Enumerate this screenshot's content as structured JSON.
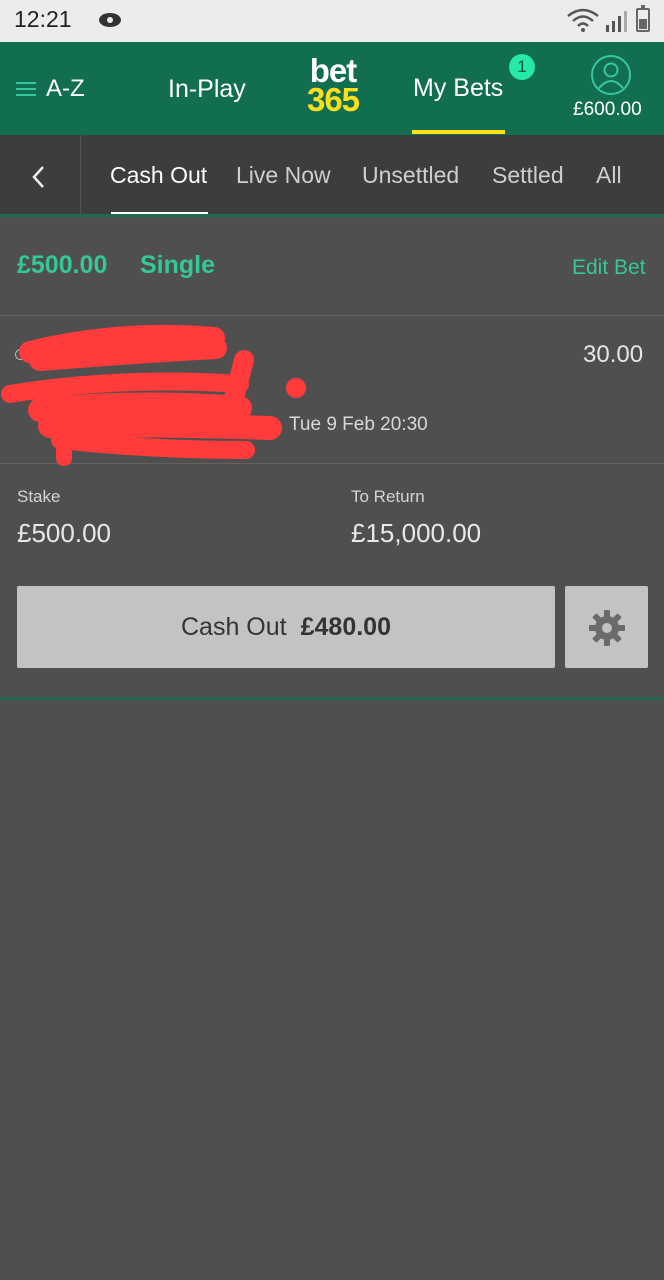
{
  "status_bar": {
    "time": "12:21"
  },
  "header": {
    "az_label": "A-Z",
    "inplay_label": "In-Play",
    "logo_line1": "bet",
    "logo_line2": "365",
    "mybets_label": "My Bets",
    "mybets_badge": "1",
    "balance": "£600.00"
  },
  "tabs": [
    {
      "label": "Cash Out",
      "active": true
    },
    {
      "label": "Live Now",
      "active": false
    },
    {
      "label": "Unsettled",
      "active": false
    },
    {
      "label": "Settled",
      "active": false
    },
    {
      "label": "All",
      "active": false
    }
  ],
  "bet": {
    "stake_title": "£500.00",
    "type": "Single",
    "edit_label": "Edit Bet",
    "odds": "30.00",
    "event_datetime": "Tue 9 Feb 20:30",
    "stake_label": "Stake",
    "stake_value": "£500.00",
    "return_label": "To Return",
    "return_value": "£15,000.00",
    "cashout_label": "Cash Out",
    "cashout_value": "£480.00"
  },
  "colors": {
    "brand_green": "#126e51",
    "accent_green": "#34c894",
    "logo_yellow": "#ffdf1b",
    "redaction_red": "#ff3b3b"
  }
}
